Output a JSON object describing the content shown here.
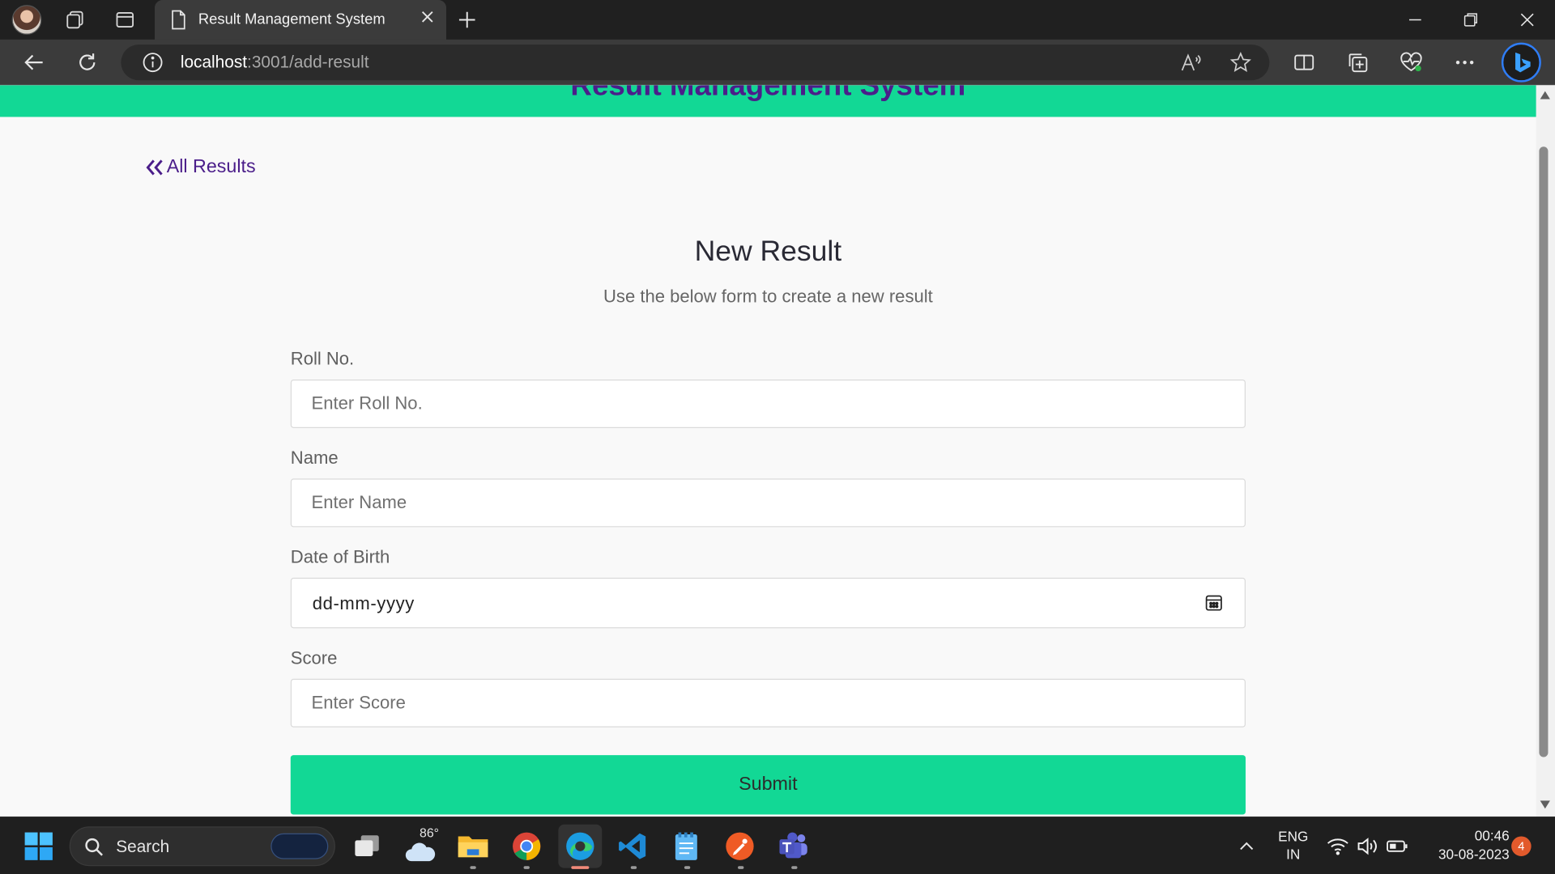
{
  "browser": {
    "tab_title": "Result Management System",
    "url_host": "localhost",
    "url_path": ":3001/add-result"
  },
  "page": {
    "brand": "Result Management System",
    "back_link": "All Results",
    "title": "New Result",
    "subtitle": "Use the below form to create a new result",
    "fields": {
      "roll": {
        "label": "Roll No.",
        "placeholder": "Enter Roll No."
      },
      "name": {
        "label": "Name",
        "placeholder": "Enter Name"
      },
      "dob": {
        "label": "Date of Birth",
        "placeholder": "dd-mm-yyyy"
      },
      "score": {
        "label": "Score",
        "placeholder": "Enter Score"
      }
    },
    "submit_label": "Submit"
  },
  "taskbar": {
    "search_label": "Search",
    "weather_temp": "86°",
    "lang_line1": "ENG",
    "lang_line2": "IN",
    "time": "00:46",
    "date": "30-08-2023",
    "notification_count": "4"
  },
  "colors": {
    "accent_green": "#12d895",
    "brand_purple": "#4b1e8a",
    "chrome_dark": "#202020"
  }
}
